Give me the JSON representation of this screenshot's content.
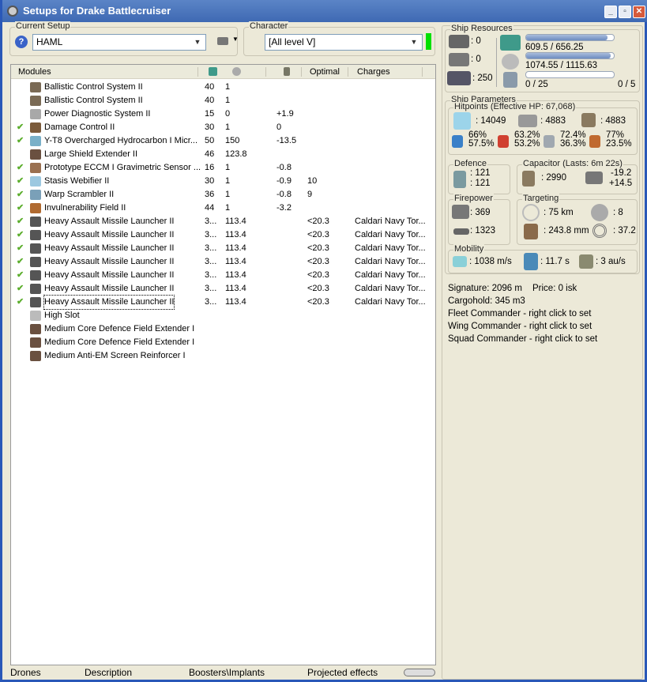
{
  "window": {
    "title": "Setups for Drake Battlecruiser",
    "buttons": [
      "_",
      "▫",
      "✕"
    ]
  },
  "setup": {
    "label": "Current Setup",
    "value": "HAML",
    "help": "?"
  },
  "character": {
    "label": "Character",
    "value": "[All level V]",
    "status_color": "#00e000"
  },
  "table": {
    "headers": [
      "Modules",
      "cpu-icon",
      "powergrid-icon",
      "capacitor-icon",
      "Optimal",
      "Charges"
    ],
    "rows": [
      {
        "checked": false,
        "name": "Ballistic Control System II",
        "cpu": "40",
        "pg": "1",
        "cap": "",
        "optimal": "",
        "charges": "",
        "color": "#7a6a55"
      },
      {
        "checked": false,
        "name": "Ballistic Control System II",
        "cpu": "40",
        "pg": "1",
        "cap": "",
        "optimal": "",
        "charges": "",
        "color": "#7a6a55"
      },
      {
        "checked": false,
        "name": "Power Diagnostic System II",
        "cpu": "15",
        "pg": "0",
        "cap": "+1.9",
        "optimal": "",
        "charges": "",
        "color": "#a8a8a8"
      },
      {
        "checked": true,
        "name": "Damage Control II",
        "cpu": "30",
        "pg": "1",
        "cap": "0",
        "optimal": "",
        "charges": "",
        "color": "#7b5a3a"
      },
      {
        "checked": true,
        "name": "Y-T8 Overcharged Hydrocarbon I Micr...",
        "cpu": "50",
        "pg": "150",
        "cap": "-13.5",
        "optimal": "",
        "charges": "",
        "color": "#7ab0c8"
      },
      {
        "checked": false,
        "name": "Large Shield Extender II",
        "cpu": "46",
        "pg": "123.8",
        "cap": "",
        "optimal": "",
        "charges": "",
        "color": "#6a5040"
      },
      {
        "checked": true,
        "name": "Prototype ECCM I Gravimetric Sensor ...",
        "cpu": "16",
        "pg": "1",
        "cap": "-0.8",
        "optimal": "",
        "charges": "",
        "color": "#9a7050"
      },
      {
        "checked": true,
        "name": "Stasis Webifier II",
        "cpu": "30",
        "pg": "1",
        "cap": "-0.9",
        "optimal": "10",
        "charges": "",
        "color": "#9cc8e0"
      },
      {
        "checked": true,
        "name": "Warp Scrambler II",
        "cpu": "36",
        "pg": "1",
        "cap": "-0.8",
        "optimal": "9",
        "charges": "",
        "color": "#7aa0b8"
      },
      {
        "checked": true,
        "name": "Invulnerability Field II",
        "cpu": "44",
        "pg": "1",
        "cap": "-3.2",
        "optimal": "",
        "charges": "",
        "color": "#b06a30"
      },
      {
        "checked": true,
        "name": "Heavy Assault Missile Launcher II",
        "cpu": "3...",
        "pg": "113.4",
        "cap": "",
        "optimal": "<20.3",
        "charges": "Caldari Navy Tor...",
        "color": "#555"
      },
      {
        "checked": true,
        "name": "Heavy Assault Missile Launcher II",
        "cpu": "3...",
        "pg": "113.4",
        "cap": "",
        "optimal": "<20.3",
        "charges": "Caldari Navy Tor...",
        "color": "#555"
      },
      {
        "checked": true,
        "name": "Heavy Assault Missile Launcher II",
        "cpu": "3...",
        "pg": "113.4",
        "cap": "",
        "optimal": "<20.3",
        "charges": "Caldari Navy Tor...",
        "color": "#555"
      },
      {
        "checked": true,
        "name": "Heavy Assault Missile Launcher II",
        "cpu": "3...",
        "pg": "113.4",
        "cap": "",
        "optimal": "<20.3",
        "charges": "Caldari Navy Tor...",
        "color": "#555"
      },
      {
        "checked": true,
        "name": "Heavy Assault Missile Launcher II",
        "cpu": "3...",
        "pg": "113.4",
        "cap": "",
        "optimal": "<20.3",
        "charges": "Caldari Navy Tor...",
        "color": "#555"
      },
      {
        "checked": true,
        "name": "Heavy Assault Missile Launcher II",
        "cpu": "3...",
        "pg": "113.4",
        "cap": "",
        "optimal": "<20.3",
        "charges": "Caldari Navy Tor...",
        "color": "#555"
      },
      {
        "checked": true,
        "name": "Heavy Assault Missile Launcher II",
        "cpu": "3...",
        "pg": "113.4",
        "cap": "",
        "optimal": "<20.3",
        "charges": "Caldari Navy Tor...",
        "color": "#555"
      },
      {
        "checked": false,
        "name": "High Slot",
        "cpu": "",
        "pg": "",
        "cap": "",
        "optimal": "",
        "charges": "",
        "color": "#bbb"
      },
      {
        "checked": false,
        "name": "Medium Core Defence Field Extender I",
        "cpu": "",
        "pg": "",
        "cap": "",
        "optimal": "",
        "charges": "",
        "color": "#6a5040"
      },
      {
        "checked": false,
        "name": "Medium Core Defence Field Extender I",
        "cpu": "",
        "pg": "",
        "cap": "",
        "optimal": "",
        "charges": "",
        "color": "#6a5040"
      },
      {
        "checked": false,
        "name": "Medium Anti-EM Screen Reinforcer I",
        "cpu": "",
        "pg": "",
        "cap": "",
        "optimal": "",
        "charges": "",
        "color": "#6a5040"
      }
    ]
  },
  "tabs": [
    "Drones",
    "Description",
    "Boosters\\Implants",
    "Projected effects"
  ],
  "resources": {
    "label": "Ship Resources",
    "turrets": ": 0",
    "launchers": ": 0",
    "calibration": ": 250",
    "cpu": "609.5 / 656.25",
    "cpu_fraction": 0.929,
    "powergrid": "1074.55 / 1115.63",
    "pg_fraction": 0.963,
    "drone_bay": "0 / 25",
    "drone_bandwidth": "0 / 5",
    "drone_fraction": 0.0
  },
  "parameters": {
    "label": "Ship Parameters",
    "hitpoints": {
      "label": "Hitpoints (Effective HP: 67,068)",
      "shield": ": 14049",
      "armor": ": 4883",
      "structure": ": 4883",
      "resists": [
        [
          "66%",
          "57.5%"
        ],
        [
          "63.2%",
          "53.2%"
        ],
        [
          "72.4%",
          "36.3%"
        ],
        [
          "77%",
          "23.5%"
        ]
      ]
    },
    "defence": {
      "label": "Defence",
      "a": ": 121",
      "b": ": 121"
    },
    "capacitor": {
      "label": "Capacitor (Lasts: 6m 22s)",
      "amount": ": 2990",
      "use": "-19.2",
      "recharge": "+14.5"
    },
    "firepower": {
      "label": "Firepower",
      "volley": ": 369",
      "dps": ": 1323"
    },
    "targeting": {
      "label": "Targeting",
      "range": ": 75 km",
      "max_targets": ": 8",
      "resolution": ": 243.8 mm",
      "sensor": ": 37.2"
    },
    "mobility": {
      "label": "Mobility",
      "speed": ": 1038 m/s",
      "align": ": 11.7 s",
      "warp": ": 3 au/s"
    },
    "signature": "Signature: 2096 m",
    "price": "Price: 0 isk",
    "cargo": "Cargohold: 345 m3",
    "fleet": "Fleet Commander - right click to set",
    "wing": "Wing Commander - right click to set",
    "squad": "Squad Commander - right click to set"
  }
}
